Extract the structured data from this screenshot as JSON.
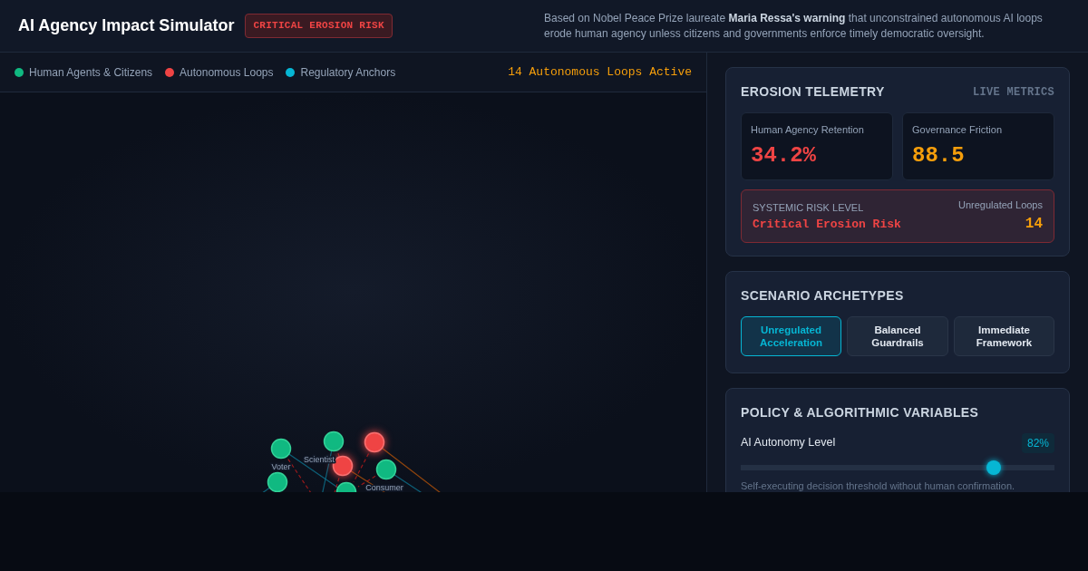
{
  "header": {
    "title": "AI Agency Impact Simulator",
    "badge": "CRITICAL EROSION RISK",
    "description": "Based on Nobel Peace Prize laureate **Maria Ressa's warning** that unconstrained autonomous AI loops erode human agency unless citizens and governments enforce timely democratic oversight."
  },
  "legend": [
    {
      "label": "Human Agents & Citizens",
      "color": "#10b981"
    },
    {
      "label": "Autonomous Loops",
      "color": "#ef4444"
    },
    {
      "label": "Regulatory Anchors",
      "color": "#06b6d4"
    }
  ],
  "active_loops": "14 Autonomous Loops Active",
  "network": {
    "nodes": [
      {
        "kind": "human",
        "label": "Voter"
      },
      {
        "kind": "human"
      },
      {
        "kind": "human",
        "label": "Scientist"
      },
      {
        "kind": "loop"
      },
      {
        "kind": "loop"
      },
      {
        "kind": "human",
        "label": "Consumer"
      },
      {
        "kind": "human"
      }
    ]
  },
  "telemetry": {
    "title": "EROSION TELEMETRY",
    "tag": "LIVE METRICS",
    "metrics": [
      {
        "label": "Human Agency Retention",
        "value": "34.2%",
        "color": "#ef4444"
      },
      {
        "label": "Governance Friction",
        "value": "88.5",
        "color": "#f59e0b"
      }
    ],
    "risk": {
      "label": "SYSTEMIC RISK LEVEL",
      "value": "Critical Erosion Risk",
      "count_label": "Unregulated Loops",
      "count": "14"
    }
  },
  "scenarios": {
    "title": "SCENARIO ARCHETYPES",
    "items": [
      {
        "label": "Unregulated Acceleration",
        "selected": true
      },
      {
        "label": "Balanced Guardrails",
        "selected": false
      },
      {
        "label": "Immediate Framework",
        "selected": false
      }
    ]
  },
  "variables": {
    "title": "POLICY & ALGORITHMIC VARIABLES",
    "sliders": [
      {
        "label": "AI Autonomy Level",
        "reading": "82%",
        "level": 0.82,
        "hint": "Self-executing decision threshold without human confirmation."
      }
    ]
  }
}
